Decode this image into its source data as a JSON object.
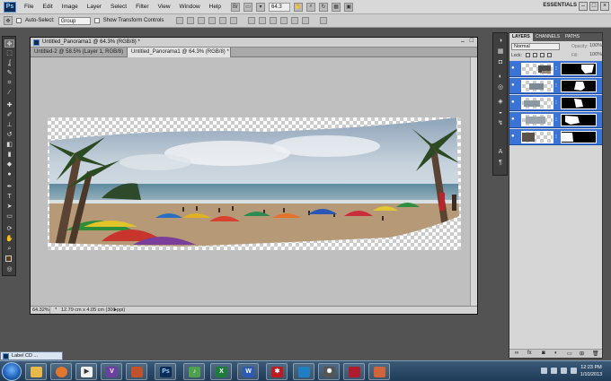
{
  "menubar": {
    "logo": "Ps",
    "items": [
      "File",
      "Edit",
      "Image",
      "Layer",
      "Select",
      "Filter",
      "View",
      "Window",
      "Help"
    ],
    "zoom_value": "64.3",
    "workspace": "ESSENTIALS"
  },
  "options_bar": {
    "auto_select_label": "Auto-Select:",
    "auto_select_value": "Group",
    "transform_label": "Show Transform Controls"
  },
  "document": {
    "window_title": "Untitled_Panorama1 @ 64.3% (RGB/8) *",
    "tabs": [
      {
        "label": "Untitled-2 @ 58.5% (Layer 1, RGB/8) *"
      },
      {
        "label": "Untitled_Panorama1 @ 64.3% (RGB/8) *"
      }
    ],
    "status_zoom": "64.32%",
    "status_info": "12.79 cm x 4.05 cm (300 ppi)"
  },
  "layers_panel": {
    "tabs": [
      "LAYERS",
      "CHANNELS",
      "PATHS"
    ],
    "blend_mode": "Normal",
    "opacity_label": "Opacity:",
    "opacity_value": "100%",
    "lock_label": "Lock:",
    "fill_label": "Fill:",
    "fill_value": "100%",
    "layer_count": 5
  },
  "minimized_window": {
    "label": "Label CD ..."
  },
  "taskbar": {
    "apps": [
      "windows-explorer",
      "firefox",
      "media-player",
      "visual-studio",
      "image-viewer",
      "photoshop",
      "sound-app",
      "excel",
      "word",
      "acrobat",
      "remote-app",
      "settings-app",
      "media-app",
      "photoshop-doc"
    ],
    "clock_time": "12:23 PM",
    "clock_date": "1/10/2013"
  }
}
